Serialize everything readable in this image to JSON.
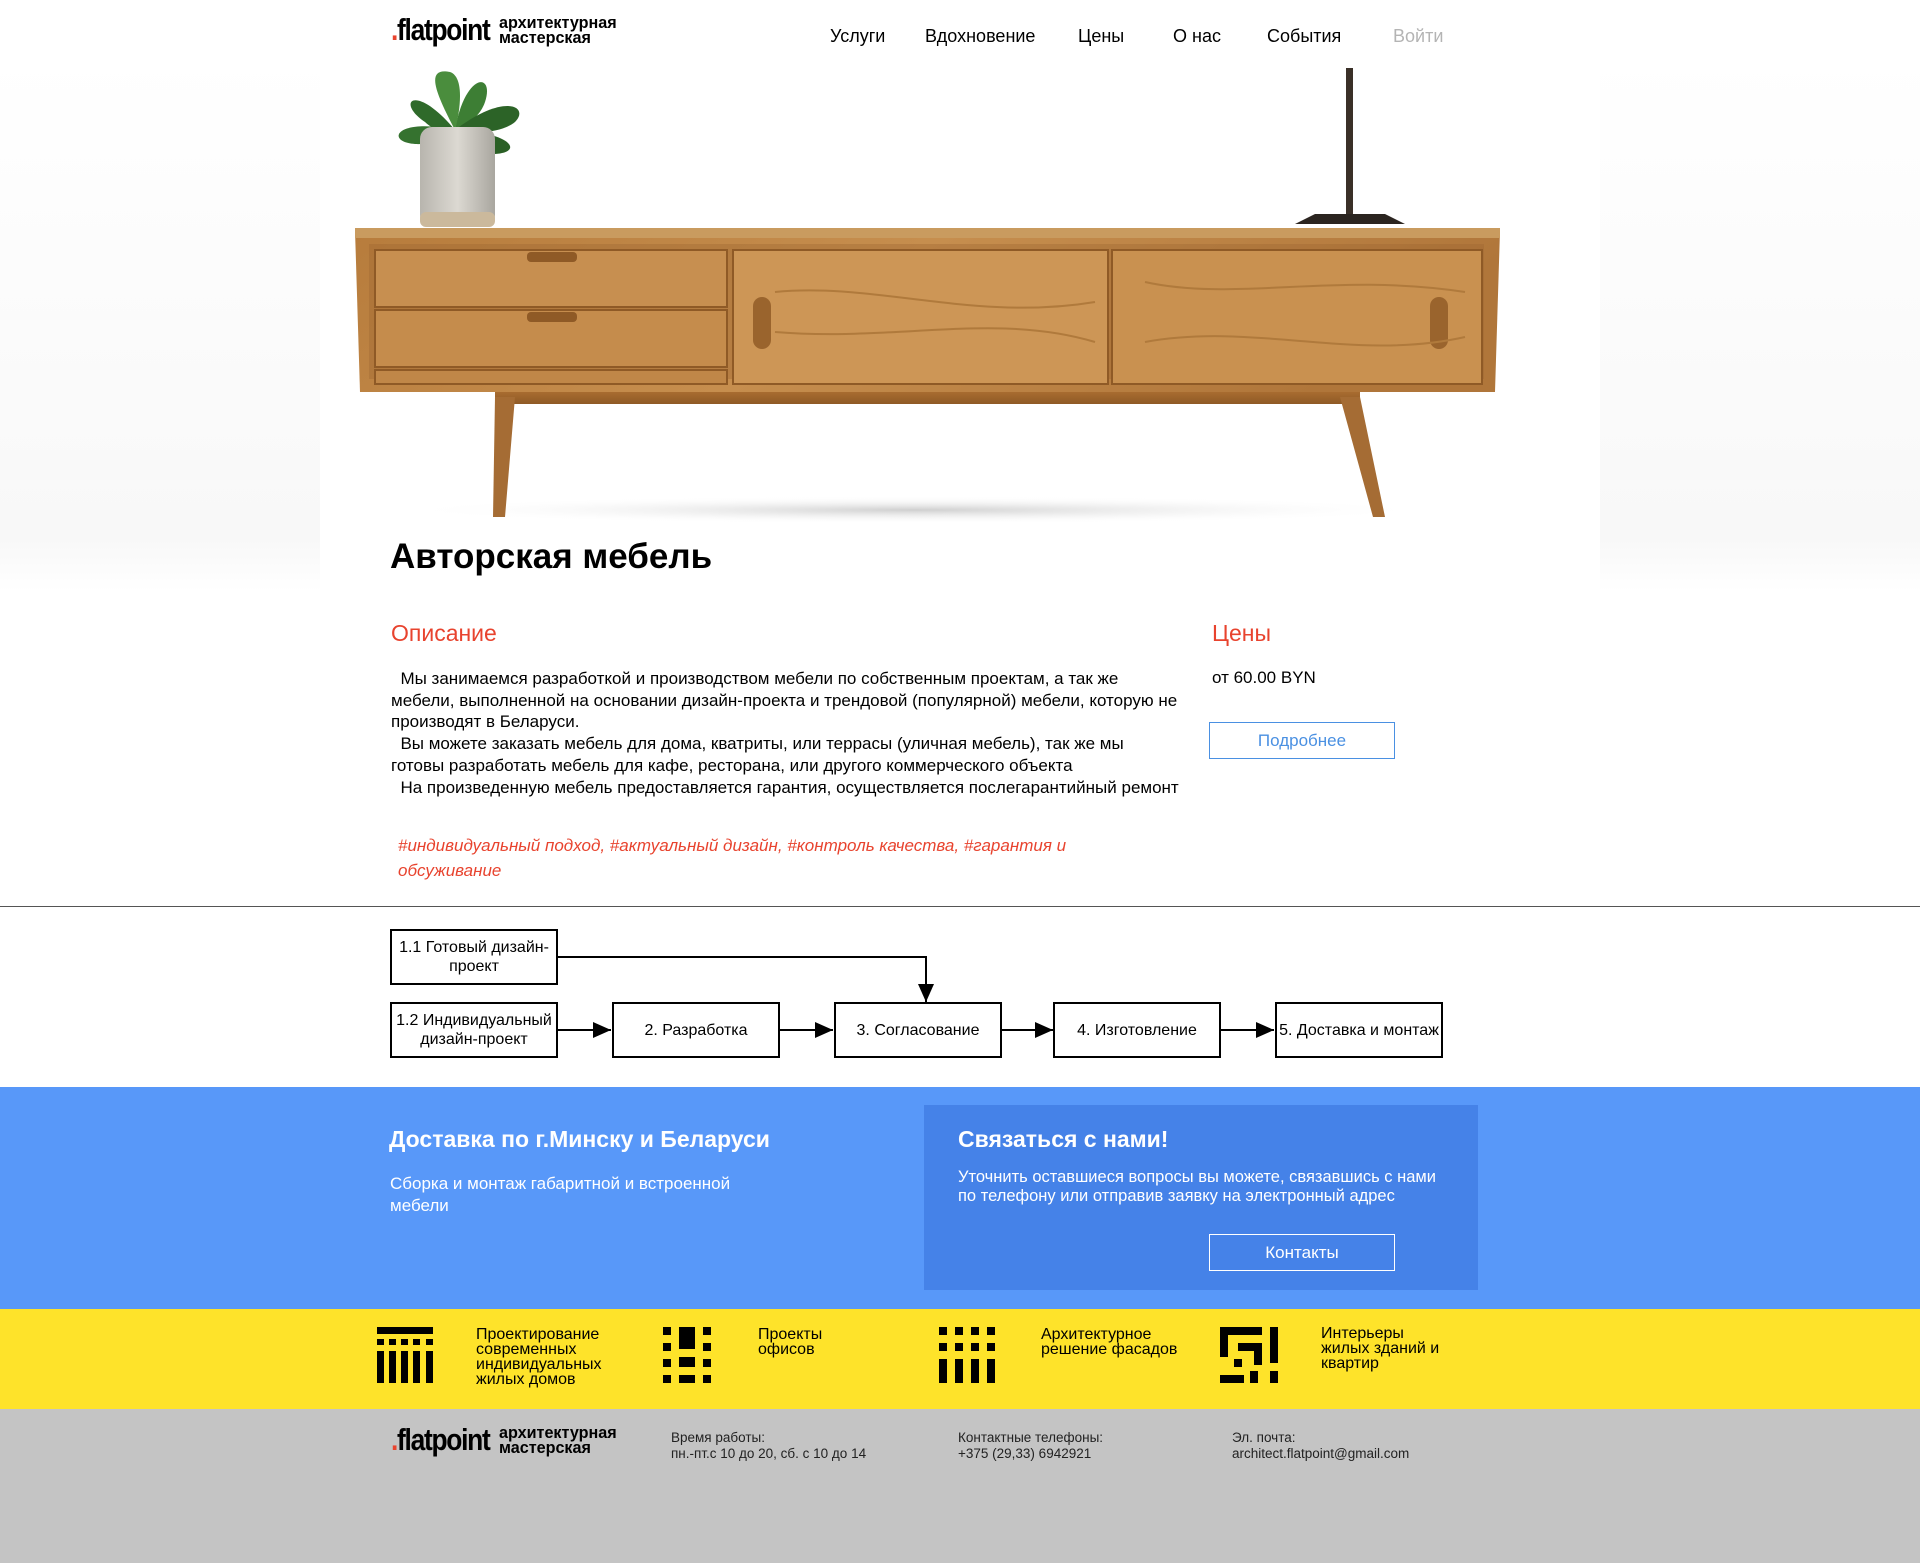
{
  "header": {
    "logo_word": "flatpoint",
    "logo_sub_line1": "архитектурная",
    "logo_sub_line2": "мастерская",
    "nav": [
      "Услуги",
      "Вдохновение",
      "Цены",
      "О нас",
      "События",
      "Войти"
    ]
  },
  "main": {
    "title": "Авторская мебель",
    "description_heading": "Описание",
    "description": [
      "  Мы занимаемся разработкой и производством мебели по собственным проектам, а так же мебели, выполненной на основании дизайн-проекта и трендовой (популярной) мебели, которую не производят в Беларуси.",
      "  Вы можете заказать мебель для дома, кватриты, или террасы (уличная мебель), так же мы готовы разработать мебель для кафе, ресторана, или другого коммерческого объекта",
      "  На произведенную мебель предоставляется гарантия, осуществляется послегарантийный ремонт"
    ],
    "tags": "#индивидуальный подход, #актуальный дизайн, #контроль качества, #гарантия и обсуживание",
    "prices_heading": "Цены",
    "price": "от 60.00 BYN",
    "more_button": "Подробнее"
  },
  "process": {
    "steps": {
      "s11": "1.1 Готовый дизайн-проект",
      "s12": "1.2 Индивидуальный дизайн-проект",
      "s2": "2. Разработка",
      "s3": "3. Согласование",
      "s4": "4. Изготовление",
      "s5": "5. Доставка и монтаж"
    }
  },
  "delivery": {
    "title": "Доставка по г.Минску и Беларуси",
    "text": "Сборка и монтаж габаритной и встроенной мебели"
  },
  "contact": {
    "title": "Связаться с нами!",
    "text": "Уточнить оставшиеся вопросы вы можете, связавшись с нами по телефону или отправив заявку на электронный адрес",
    "button": "Контакты"
  },
  "services": [
    {
      "icon": "residential-houses-icon",
      "label": "Проектирование современных индивидуальных жилых домов"
    },
    {
      "icon": "office-building-icon",
      "label": "Проекты офисов"
    },
    {
      "icon": "facade-icon",
      "label": "Архитектурное решение фасадов"
    },
    {
      "icon": "interior-icon",
      "label": "Интерьеры жилых зданий и квартир"
    }
  ],
  "footer": {
    "hours_label": "Время работы:",
    "hours_value": "пн.-пт.с 10 до 20, сб. с 10 до 14",
    "phones_label": "Контактные телефоны:",
    "phones_value": "+375 (29,33) 6942921",
    "email_label": "Эл. почта:",
    "email_value": "architect.flatpoint@gmail.com"
  },
  "colors": {
    "accent_red": "#e8432e",
    "link_blue": "#4a90e2",
    "band_blue": "#5898f9",
    "box_blue": "#4582e8",
    "band_yellow": "#fee32a",
    "footer_gray": "#c4c4c4"
  }
}
